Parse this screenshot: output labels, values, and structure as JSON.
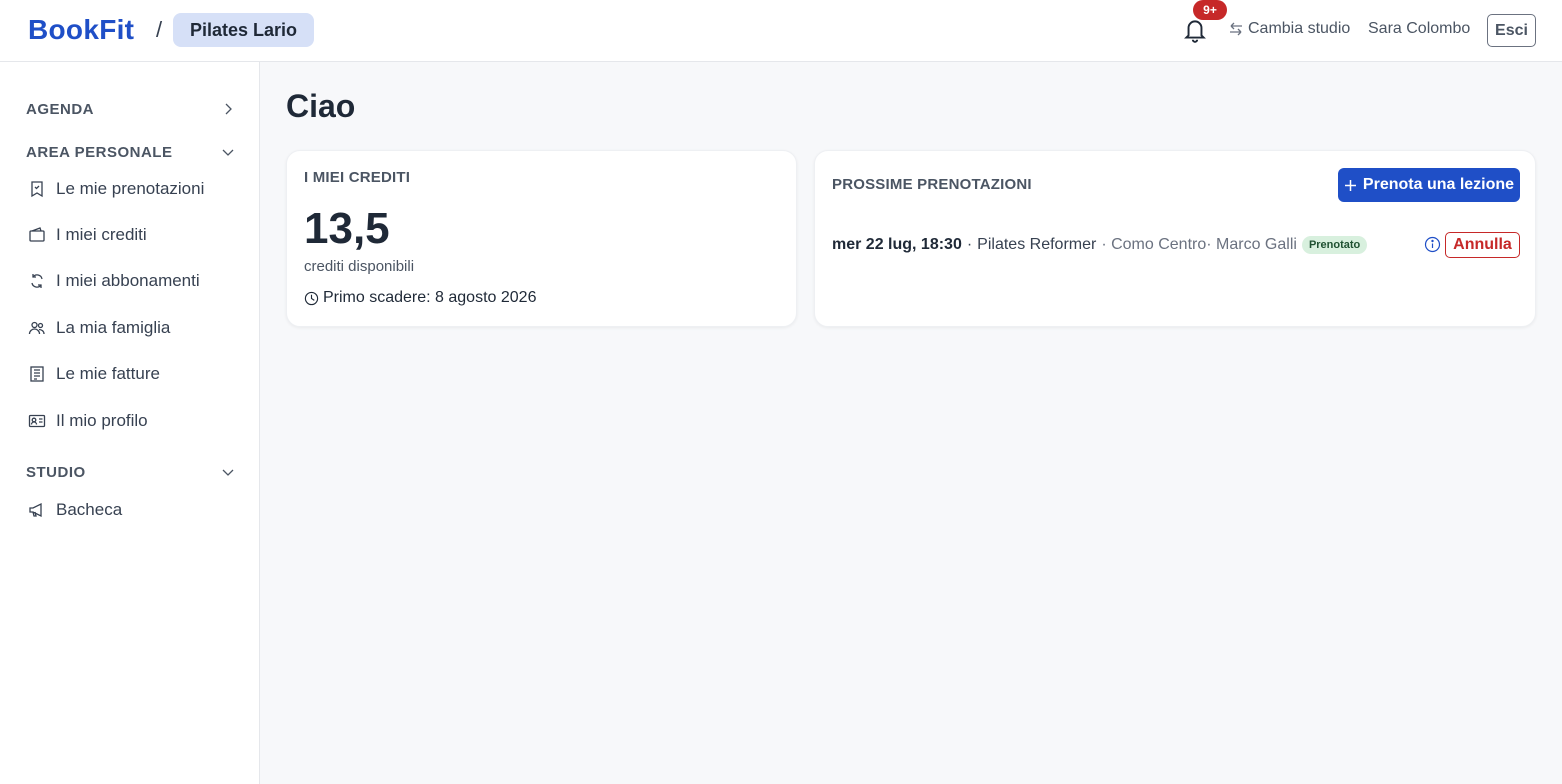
{
  "header": {
    "logo": "BookFit",
    "separator": "/",
    "studio": "Pilates Lario",
    "notifications_badge": "9+",
    "switch_label": "Cambia studio",
    "user_name": "Sara Colombo",
    "logout_label": "Esci"
  },
  "sidebar": {
    "sections": [
      {
        "label": "AGENDA",
        "state": "collapsed",
        "items": []
      },
      {
        "label": "AREA PERSONALE",
        "state": "expanded",
        "items": [
          {
            "label": "Le mie prenotazioni",
            "icon": "bookmark-icon"
          },
          {
            "label": "I miei crediti",
            "icon": "wallet-icon"
          },
          {
            "label": "I miei abbonamenti",
            "icon": "refresh-icon"
          },
          {
            "label": "La mia famiglia",
            "icon": "people-icon"
          },
          {
            "label": "Le mie fatture",
            "icon": "invoice-icon"
          },
          {
            "label": "Il mio profilo",
            "icon": "id-card-icon"
          }
        ]
      },
      {
        "label": "STUDIO",
        "state": "expanded",
        "items": [
          {
            "label": "Bacheca",
            "icon": "megaphone-icon"
          }
        ]
      }
    ]
  },
  "main": {
    "greeting": "Ciao",
    "credits": {
      "title": "I MIEI CREDITI",
      "amount": "13,5",
      "subtitle": "crediti disponibili",
      "expiry": "Primo scadere: 8 agosto 2026"
    },
    "bookings": {
      "title": "PROSSIME PRENOTAZIONI",
      "book_button": "Prenota una lezione",
      "items": [
        {
          "datetime": "mer 22 lug, 18:30",
          "separator": "·",
          "class": "Pilates Reformer",
          "location": "· Como Centro· Marco Galli",
          "status": "Prenotato",
          "cancel": "Annulla"
        }
      ]
    }
  },
  "colors": {
    "brand": "#1f4fc7",
    "danger": "#c62828",
    "success_bg": "#d8f0de",
    "pill_bg": "#d6e0f7"
  }
}
